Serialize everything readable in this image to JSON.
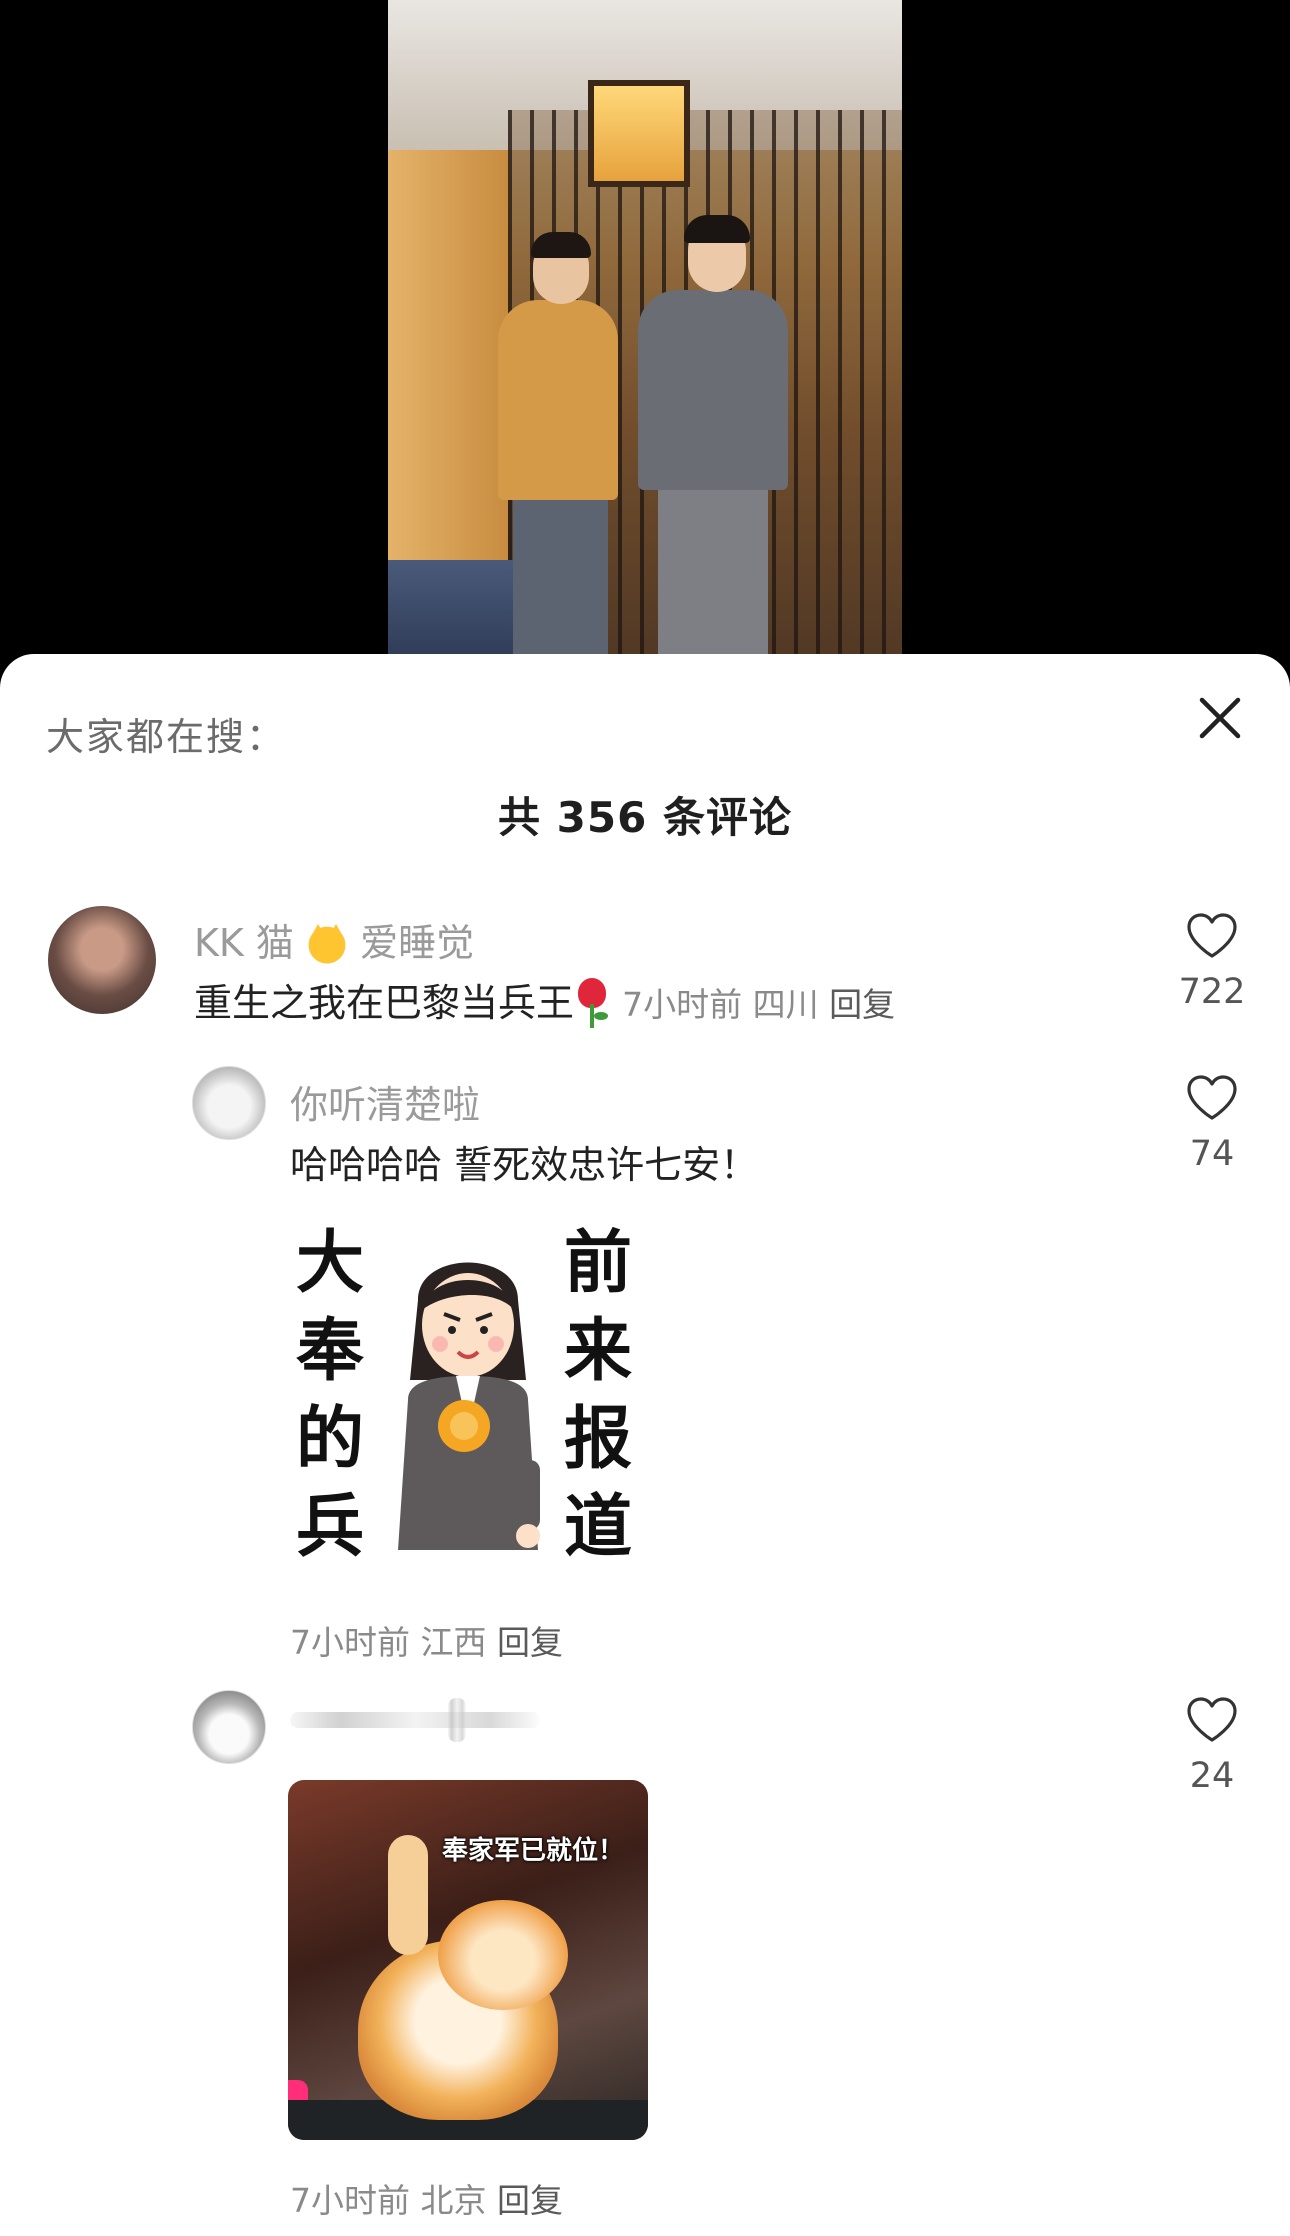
{
  "search": {
    "label": "大家都在搜："
  },
  "comments_header": {
    "title": "共 356 条评论"
  },
  "comments": [
    {
      "username_prefix": "KK 猫",
      "username_suffix": "爱睡觉",
      "text": "重生之我在巴黎当兵王",
      "time": "7小时前",
      "location": "四川",
      "reply_label": "回复",
      "likes": "722"
    }
  ],
  "replies": [
    {
      "username": "你听清楚啦",
      "text": "哈哈哈哈 誓死效忠许七安！",
      "sticker": {
        "left_chars": [
          "大",
          "奉",
          "的",
          "兵"
        ],
        "right_chars": [
          "前",
          "来",
          "报",
          "道"
        ]
      },
      "time": "7小时前",
      "location": "江西",
      "reply_label": "回复",
      "likes": "74"
    },
    {
      "username": "",
      "sticker": {
        "caption": "奉家军已就位！"
      },
      "time": "7小时前",
      "location": "北京",
      "reply_label": "回复",
      "likes": "24"
    }
  ],
  "colors": {
    "sheet_bg": "#ffffff",
    "meta_text": "#8a8a8a",
    "username_text": "#9a9a9a",
    "body_text": "#222222"
  },
  "icons": {
    "close": "close-icon",
    "like": "heart-outline-icon"
  }
}
